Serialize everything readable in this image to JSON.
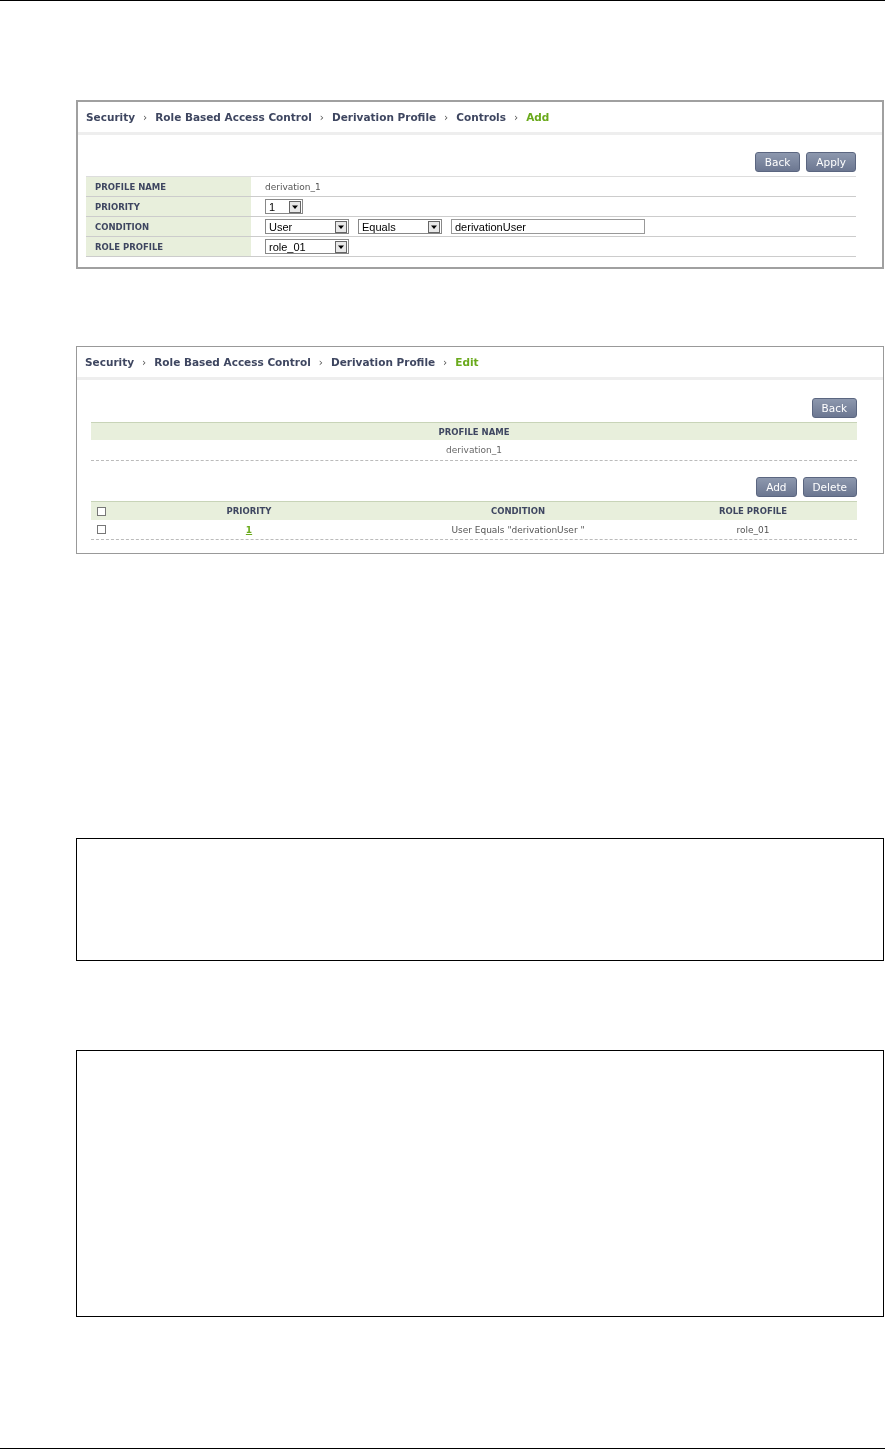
{
  "add_panel": {
    "breadcrumb": [
      {
        "label": "Security",
        "selected": false
      },
      {
        "label": "Role Based Access Control",
        "selected": false
      },
      {
        "label": "Derivation Profile",
        "selected": false
      },
      {
        "label": "Controls",
        "selected": false
      },
      {
        "label": "Add",
        "selected": true
      }
    ],
    "separator": "›",
    "buttons": [
      "Back",
      "Apply"
    ],
    "fields": [
      {
        "kind": "text",
        "label": "PROFILE NAME",
        "value": "derivation_1"
      },
      {
        "kind": "select",
        "label": "PRIORITY",
        "selects": [
          {
            "value": "1"
          }
        ]
      },
      {
        "kind": "select",
        "label": "CONDITION",
        "selects": [
          {
            "value": "User"
          },
          {
            "value": "Equals"
          }
        ],
        "input": "derivationUser"
      },
      {
        "kind": "select",
        "label": "ROLE PROFILE",
        "selects": [
          {
            "value": "role_01"
          }
        ]
      }
    ]
  },
  "edit_panel": {
    "breadcrumb": [
      {
        "label": "Security",
        "selected": false
      },
      {
        "label": "Role Based Access Control",
        "selected": false
      },
      {
        "label": "Derivation Profile",
        "selected": false
      },
      {
        "label": "Edit",
        "selected": true
      }
    ],
    "separator": "›",
    "top_buttons": [
      "Back"
    ],
    "profile_header": "PROFILE NAME",
    "profile_value": "derivation_1",
    "table_buttons": [
      "Add",
      "Delete"
    ],
    "table": {
      "select_all": {
        "checked": false
      },
      "columns": [
        "PRIORITY",
        "CONDITION",
        "ROLE PROFILE"
      ],
      "rows": [
        {
          "checked": false,
          "priority": "1",
          "condition": "User Equals \"derivationUser \"",
          "role_profile": "role_01"
        }
      ]
    }
  }
}
